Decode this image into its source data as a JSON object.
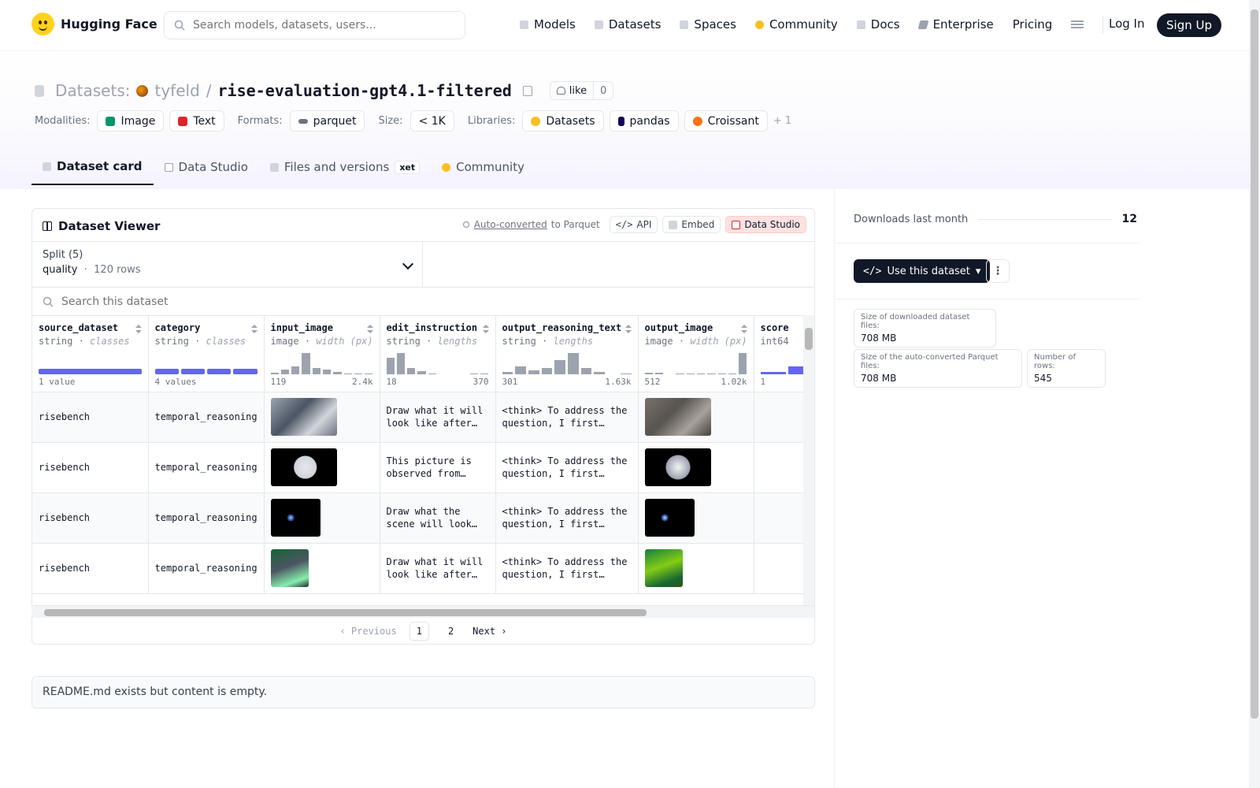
{
  "nav": {
    "logo_text": "Hugging Face",
    "search_placeholder": "Search models, datasets, users...",
    "links": [
      "Models",
      "Datasets",
      "Spaces",
      "Community",
      "Docs",
      "Enterprise",
      "Pricing"
    ],
    "login": "Log In",
    "signup": "Sign Up"
  },
  "header": {
    "section": "Datasets:",
    "owner": "tyfeld",
    "slash": "/",
    "repo": "rise-evaluation-gpt4.1-filtered",
    "like_label": "like",
    "like_count": "0",
    "modalities_label": "Modalities:",
    "modalities": [
      "Image",
      "Text"
    ],
    "formats_label": "Formats:",
    "format": "parquet",
    "size_label": "Size:",
    "size": "< 1K",
    "libraries_label": "Libraries:",
    "libraries": [
      "Datasets",
      "pandas",
      "Croissant"
    ],
    "more_libraries": "+ 1"
  },
  "tabs": [
    "Dataset card",
    "Data Studio",
    "Files and versions",
    "Community"
  ],
  "tab_badge": "xet",
  "viewer": {
    "title": "Dataset Viewer",
    "auto_converted": "Auto-converted",
    "to_parquet": "to Parquet",
    "api": "API",
    "embed": "Embed",
    "data_studio": "Data Studio",
    "split_label": "Split (5)",
    "split_value": "quality",
    "split_rows": "120 rows",
    "search_placeholder": "Search this dataset",
    "columns": [
      {
        "name": "source_dataset",
        "type": "string",
        "sub": "classes",
        "foot_l": "1 value",
        "foot_r": ""
      },
      {
        "name": "category",
        "type": "string",
        "sub": "classes",
        "foot_l": "4 values",
        "foot_r": ""
      },
      {
        "name": "input_image",
        "type": "image",
        "sub": "width (px)",
        "foot_l": "119",
        "foot_r": "2.4k"
      },
      {
        "name": "edit_instruction",
        "type": "string",
        "sub": "lengths",
        "foot_l": "18",
        "foot_r": "370"
      },
      {
        "name": "output_reasoning_text",
        "type": "string",
        "sub": "lengths",
        "foot_l": "301",
        "foot_r": "1.63k"
      },
      {
        "name": "output_image",
        "type": "image",
        "sub": "width (px)",
        "foot_l": "512",
        "foot_r": "1.02k"
      },
      {
        "name": "score",
        "type": "int64",
        "sub": "",
        "foot_l": "1",
        "foot_r": ""
      }
    ],
    "rows": [
      {
        "source": "risebench",
        "category": "temporal_reasoning",
        "instruction": "Draw what it will look like after…",
        "reasoning": "<think> To address the question, I first…"
      },
      {
        "source": "risebench",
        "category": "temporal_reasoning",
        "instruction": "This picture is observed from the…",
        "reasoning": "<think> To address the question, I first note…"
      },
      {
        "source": "risebench",
        "category": "temporal_reasoning",
        "instruction": "Draw what the scene will look…",
        "reasoning": "<think> To address the question, I first…"
      },
      {
        "source": "risebench",
        "category": "temporal_reasoning",
        "instruction": "Draw what it will look like after a…",
        "reasoning": "<think> To address the question, I first…"
      }
    ],
    "pager": {
      "prev": "Previous",
      "pages": [
        "1",
        "2"
      ],
      "next": "Next"
    }
  },
  "readme": "README.md exists but content is empty.",
  "sidebar": {
    "downloads_label": "Downloads last month",
    "downloads": "12",
    "use_button": "Use this dataset",
    "stats": [
      {
        "k": "Size of downloaded dataset files:",
        "v": "708 MB"
      },
      {
        "k": "Size of the auto-converted Parquet files:",
        "v": "708 MB"
      },
      {
        "k": "Number of rows:",
        "v": "545"
      }
    ]
  },
  "colors": {
    "accent_bar": "#6366f1",
    "histogram": "#9ca3af",
    "dark_button": "#111827"
  }
}
